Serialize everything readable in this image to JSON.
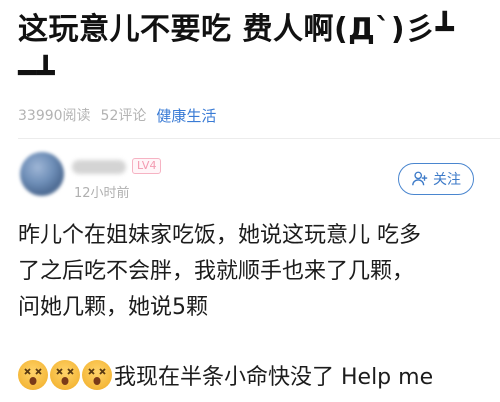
{
  "post": {
    "title_line1": "这玩意儿不要吃 费人啊(Д`)彡┻",
    "title_line2": "━┻",
    "reads": "33990阅读",
    "comments": "52评论",
    "category": "健康生活"
  },
  "comment": {
    "username": "",
    "level": "LV4",
    "time": "12小时前",
    "follow_label": "关注",
    "lines": [
      "昨儿个在姐妹家吃饭，她说这玩意儿 吃多",
      "了之后吃不会胖，我就顺手也来了几颗，",
      "问她几颗，她说5颗"
    ],
    "last_line": "我现在半条小命快没了 Help me"
  },
  "colors": {
    "accent": "#3a7bd5",
    "level_badge": "#f39ab0",
    "meta_gray": "#b3b3b3"
  },
  "icons": {
    "follow": "add-user-icon",
    "emoji": "dizzy-face-emoji-icon"
  }
}
